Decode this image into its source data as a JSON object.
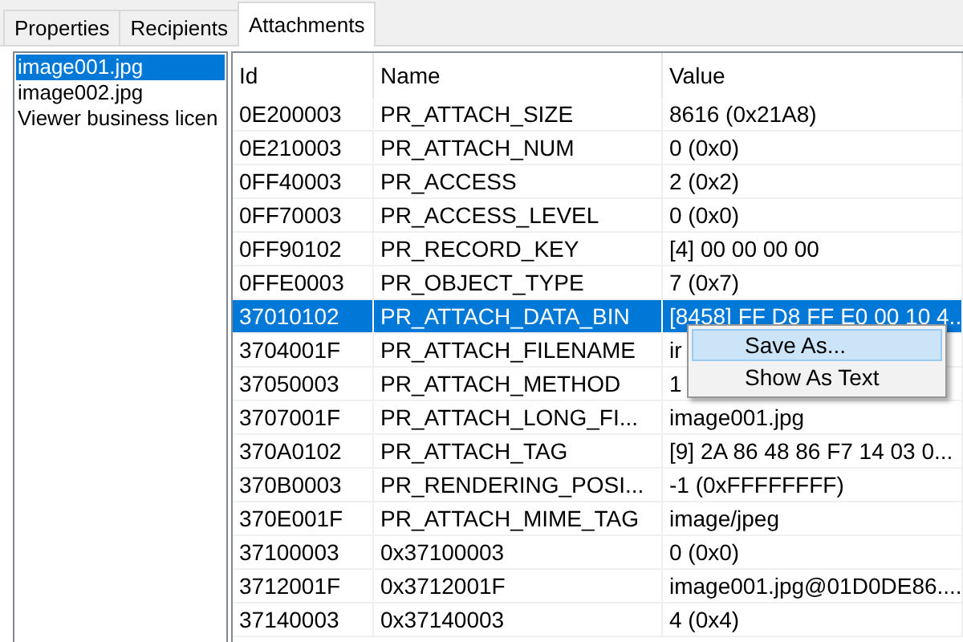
{
  "tabs": [
    {
      "label": "Properties",
      "selected": false
    },
    {
      "label": "Recipients",
      "selected": false
    },
    {
      "label": "Attachments",
      "selected": true
    }
  ],
  "attachments": [
    {
      "label": "image001.jpg",
      "selected": true
    },
    {
      "label": "image002.jpg",
      "selected": false
    },
    {
      "label": "Viewer business licen",
      "selected": false
    }
  ],
  "table": {
    "columns": [
      "Id",
      "Name",
      "Value"
    ],
    "rows": [
      {
        "cells": [
          "0E200003",
          "PR_ATTACH_SIZE",
          "8616 (0x21A8)"
        ],
        "selected": false
      },
      {
        "cells": [
          "0E210003",
          "PR_ATTACH_NUM",
          "0 (0x0)"
        ],
        "selected": false
      },
      {
        "cells": [
          "0FF40003",
          "PR_ACCESS",
          "2 (0x2)"
        ],
        "selected": false
      },
      {
        "cells": [
          "0FF70003",
          "PR_ACCESS_LEVEL",
          "0 (0x0)"
        ],
        "selected": false
      },
      {
        "cells": [
          "0FF90102",
          "PR_RECORD_KEY",
          "[4] 00 00 00 00"
        ],
        "selected": false
      },
      {
        "cells": [
          "0FFE0003",
          "PR_OBJECT_TYPE",
          "7 (0x7)"
        ],
        "selected": false
      },
      {
        "cells": [
          "37010102",
          "PR_ATTACH_DATA_BIN",
          "[8458] FF D8 FF E0 00 10 4..."
        ],
        "selected": true
      },
      {
        "cells": [
          "3704001F",
          "PR_ATTACH_FILENAME",
          "ir"
        ],
        "selected": false
      },
      {
        "cells": [
          "37050003",
          "PR_ATTACH_METHOD",
          "1"
        ],
        "selected": false
      },
      {
        "cells": [
          "3707001F",
          "PR_ATTACH_LONG_FI...",
          "image001.jpg"
        ],
        "selected": false
      },
      {
        "cells": [
          "370A0102",
          "PR_ATTACH_TAG",
          "[9] 2A 86 48 86 F7 14 03 0..."
        ],
        "selected": false
      },
      {
        "cells": [
          "370B0003",
          "PR_RENDERING_POSI...",
          "-1 (0xFFFFFFFF)"
        ],
        "selected": false
      },
      {
        "cells": [
          "370E001F",
          "PR_ATTACH_MIME_TAG",
          "image/jpeg"
        ],
        "selected": false
      },
      {
        "cells": [
          "37100003",
          "0x37100003",
          "0 (0x0)"
        ],
        "selected": false
      },
      {
        "cells": [
          "3712001F",
          "0x3712001F",
          "image001.jpg@01D0DE86...."
        ],
        "selected": false
      },
      {
        "cells": [
          "37140003",
          "0x37140003",
          "4 (0x4)"
        ],
        "selected": false
      }
    ]
  },
  "context_menu": [
    {
      "label": "Save As...",
      "selected": true
    },
    {
      "label": "Show As Text",
      "selected": false
    }
  ]
}
